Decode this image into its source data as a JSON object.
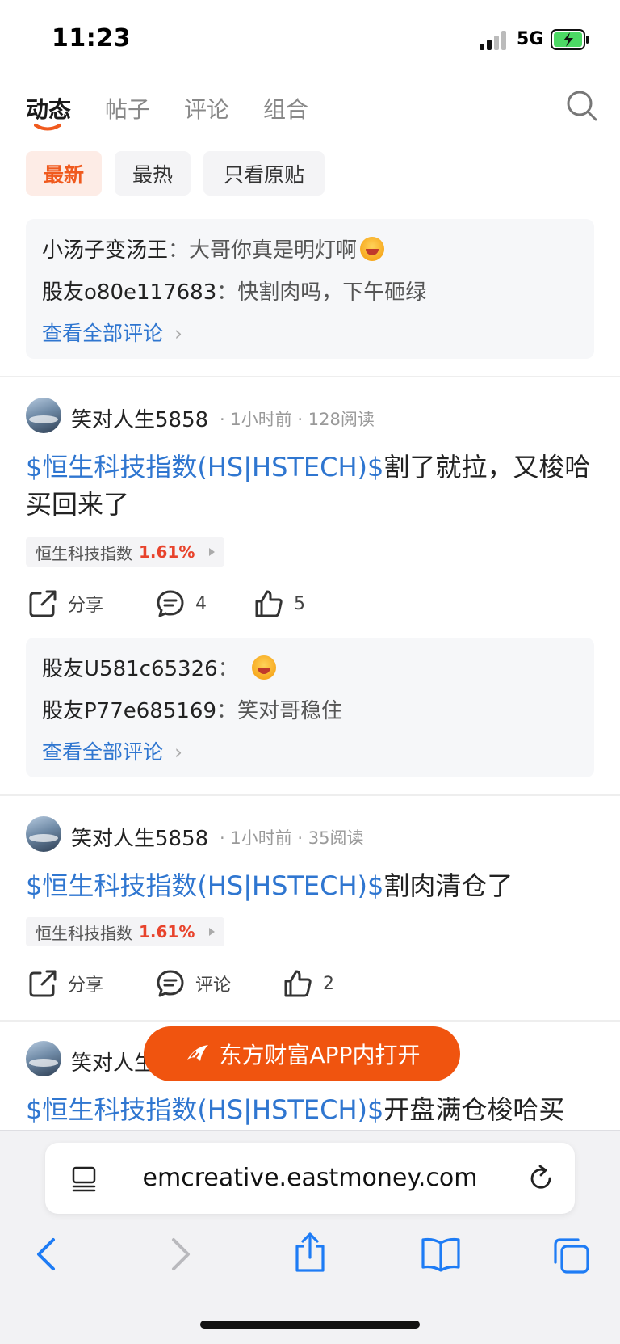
{
  "status_bar": {
    "time": "11:23",
    "network": "5G"
  },
  "tabs": [
    {
      "label": "动态",
      "active": true
    },
    {
      "label": "帖子",
      "active": false
    },
    {
      "label": "评论",
      "active": false
    },
    {
      "label": "组合",
      "active": false
    }
  ],
  "filters": [
    {
      "label": "最新",
      "active": true
    },
    {
      "label": "最热",
      "active": false
    },
    {
      "label": "只看原贴",
      "active": false
    }
  ],
  "top_comments": {
    "lines": [
      {
        "user": "小汤子变汤王",
        "text": "大哥你真是明灯啊"
      },
      {
        "user": "股友o80e117683",
        "text": "快割肉吗，下午砸绿"
      }
    ],
    "see_all": "查看全部评论"
  },
  "posts": [
    {
      "author": "笑对人生5858",
      "time": "1小时前",
      "reads": "128阅读",
      "stock": "$恒生科技指数(HS|HSTECH)$",
      "text": "割了就拉，又梭哈买回来了",
      "quote": {
        "name": "恒生科技指数",
        "change": "1.61%"
      },
      "share_label": "分享",
      "comment_label": "4",
      "like_count": "5",
      "comments": {
        "lines": [
          {
            "user": "股友U581c65326",
            "text": ""
          },
          {
            "user": "股友P77e685169",
            "text": "笑对哥稳住"
          }
        ],
        "see_all": "查看全部评论"
      }
    },
    {
      "author": "笑对人生5858",
      "time": "1小时前",
      "reads": "35阅读",
      "stock": "$恒生科技指数(HS|HSTECH)$",
      "text": "割肉清仓了",
      "quote": {
        "name": "恒生科技指数",
        "change": "1.61%"
      },
      "share_label": "分享",
      "comment_label": "评论",
      "like_count": "2"
    },
    {
      "author": "笑对人生",
      "stock": "$恒生科技指数(HS|HSTECH)$",
      "text": "开盘满仓梭哈买"
    }
  ],
  "open_app_button": "东方财富APP内打开",
  "browser": {
    "url": "emcreative.eastmoney.com"
  },
  "colors": {
    "accent": "#f05a1e",
    "link": "#2f76d0",
    "up": "#e8432c"
  }
}
